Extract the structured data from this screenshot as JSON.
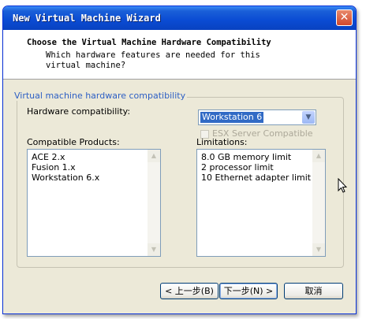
{
  "window": {
    "title": "New Virtual Machine Wizard"
  },
  "header": {
    "title": "Choose the Virtual Machine Hardware Compatibility",
    "subtitle": "Which hardware features are needed for this virtual machine?"
  },
  "group": {
    "legend": "Virtual machine hardware compatibility",
    "hardware_label": "Hardware compatibility:",
    "hardware_value": "Workstation 6",
    "esx_label": "ESX Server Compatible",
    "esx_checked": false,
    "products_label": "Compatible Products:",
    "products": [
      "ACE 2.x",
      "Fusion 1.x",
      "Workstation 6.x"
    ],
    "limits_label": "Limitations:",
    "limits": [
      "8.0 GB memory limit",
      "2 processor limit",
      "10 Ethernet adapter limit"
    ]
  },
  "buttons": {
    "back": "< 上一步(B)",
    "next": "下一步(N) >",
    "cancel": "取消"
  },
  "icons": [
    "close-icon",
    "dropdown-arrow-icon",
    "scroll-up-icon",
    "scroll-down-icon",
    "mouse-cursor-icon"
  ]
}
